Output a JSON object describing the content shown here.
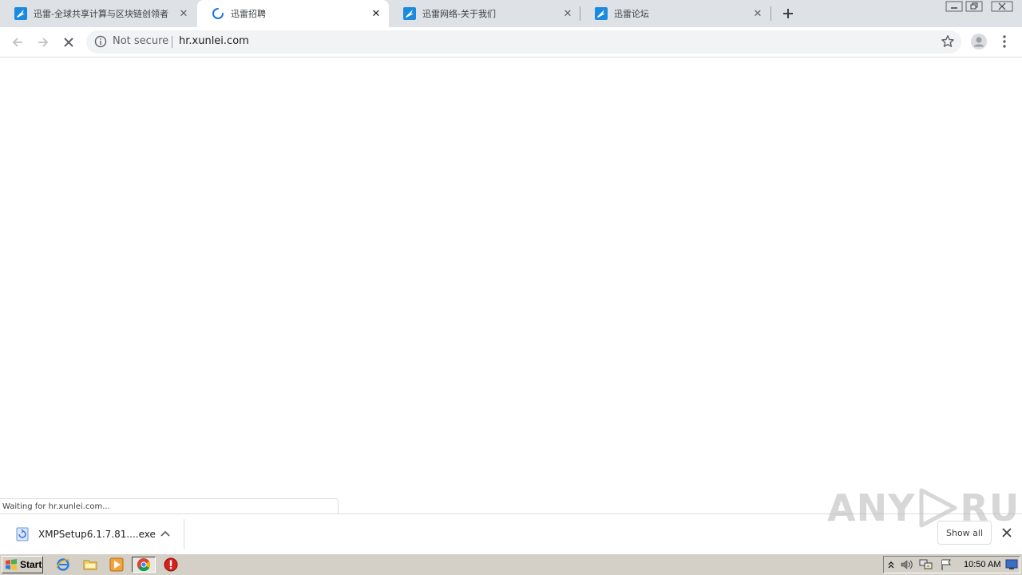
{
  "tabs": [
    {
      "title": "迅雷-全球共享计算与区块链创领者",
      "favicon": "xunlei-logo-icon",
      "active": false
    },
    {
      "title": "迅雷招聘",
      "favicon": "loading-spinner-icon",
      "active": true
    },
    {
      "title": "迅雷网络-关于我们",
      "favicon": "xunlei-logo-icon",
      "active": false
    },
    {
      "title": "迅雷论坛",
      "favicon": "xunlei-logo-icon",
      "active": false
    }
  ],
  "omnibox": {
    "security_label": "Not secure",
    "url": "hr.xunlei.com"
  },
  "status_bar": {
    "text": "Waiting for hr.xunlei.com..."
  },
  "downloads": {
    "item_name": "XMPSetup6.1.7.81....exe",
    "show_all_label": "Show all"
  },
  "watermark": {
    "left": "ANY",
    "right": "RUN"
  },
  "taskbar": {
    "start_label": "Start",
    "clock": "10:50 AM"
  },
  "colors": {
    "tabstrip": "#dee1e6",
    "omnibox": "#f1f3f4",
    "taskbar": "#d4d0c8",
    "accent_blue": "#1a73e8",
    "xunlei_blue": "#1a8ae0"
  }
}
